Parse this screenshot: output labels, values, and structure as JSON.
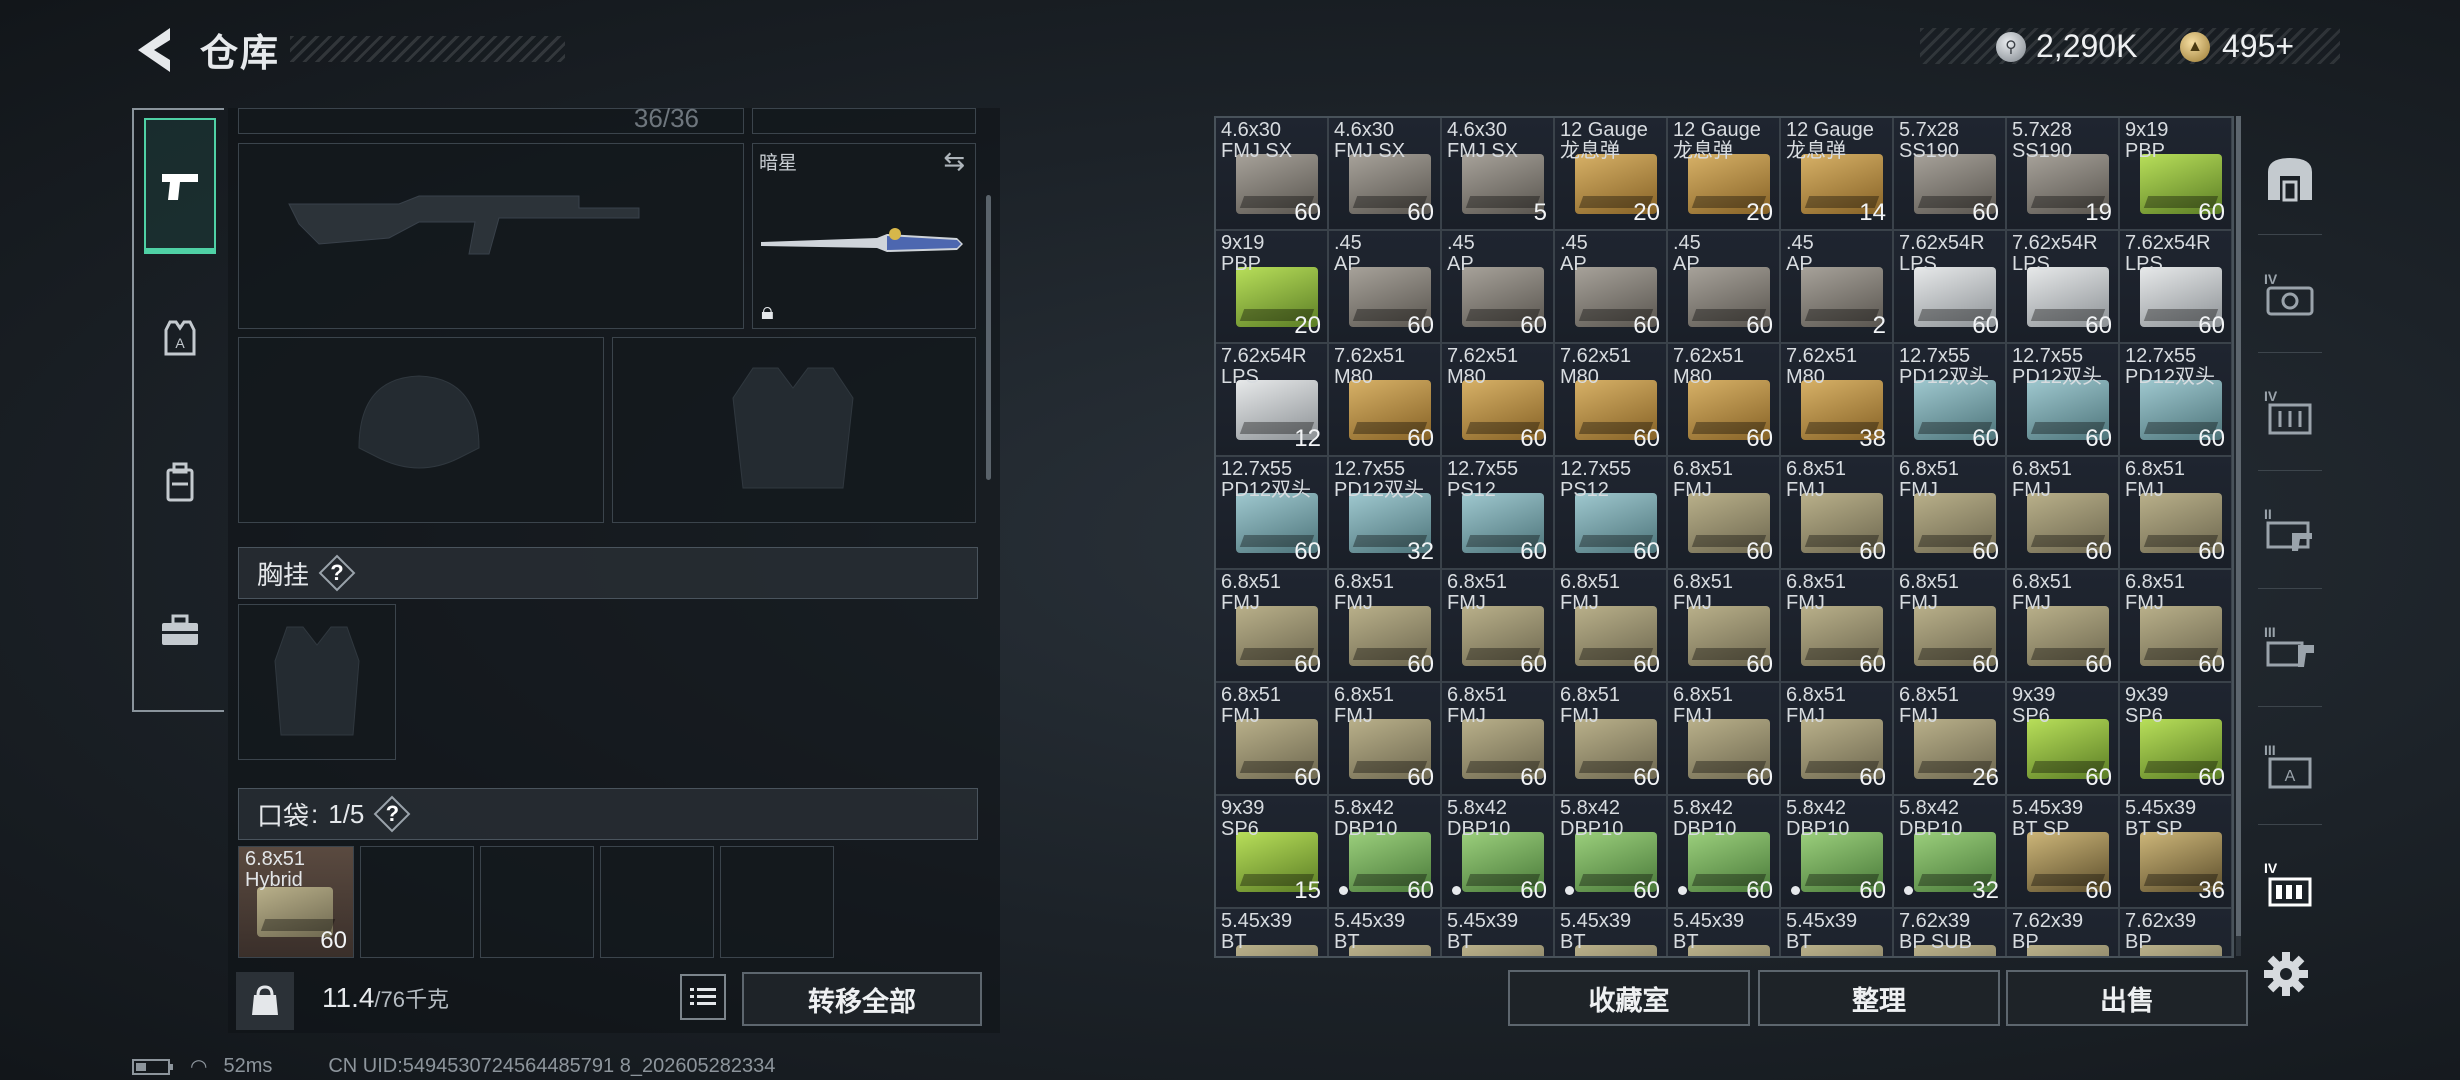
{
  "header": {
    "title": "仓库"
  },
  "currency": {
    "silver": "2,290K",
    "gold": "495+"
  },
  "left_nav": {
    "items": [
      "weapons",
      "armor",
      "backpack",
      "tools"
    ]
  },
  "equipment": {
    "top_partial_text": "36/36",
    "melee_name": "暗星",
    "chest_rig_label": "胸挂",
    "pocket_label": "口袋",
    "pocket_count": "1/5",
    "pocket_item": {
      "name": "6.8x51\nHybrid",
      "qty": "60"
    }
  },
  "bottom_left": {
    "weight": "11.4",
    "weight_max": "/76千克",
    "transfer_all": "转移全部"
  },
  "inventory_items": [
    {
      "name": "4.6x30\nFMJ SX",
      "qty": "60",
      "box": "gray"
    },
    {
      "name": "4.6x30\nFMJ SX",
      "qty": "60",
      "box": "gray"
    },
    {
      "name": "4.6x30\nFMJ SX",
      "qty": "5",
      "box": "gray"
    },
    {
      "name": "12 Gauge\n龙息弹",
      "qty": "20",
      "box": "gold"
    },
    {
      "name": "12 Gauge\n龙息弹",
      "qty": "20",
      "box": "gold"
    },
    {
      "name": "12 Gauge\n龙息弹",
      "qty": "14",
      "box": "gold"
    },
    {
      "name": "5.7x28\nSS190",
      "qty": "60",
      "box": "gray"
    },
    {
      "name": "5.7x28\nSS190",
      "qty": "19",
      "box": "gray"
    },
    {
      "name": "9x19\nPBP",
      "qty": "60",
      "box": "green"
    },
    {
      "name": "9x19\nPBP",
      "qty": "20",
      "box": "green"
    },
    {
      "name": ".45\nAP",
      "qty": "60",
      "box": "gray"
    },
    {
      "name": ".45\nAP",
      "qty": "60",
      "box": "gray"
    },
    {
      "name": ".45\nAP",
      "qty": "60",
      "box": "gray"
    },
    {
      "name": ".45\nAP",
      "qty": "60",
      "box": "gray"
    },
    {
      "name": ".45\nAP",
      "qty": "2",
      "box": "gray"
    },
    {
      "name": "7.62x54R\nLPS",
      "qty": "60",
      "box": "white"
    },
    {
      "name": "7.62x54R\nLPS",
      "qty": "60",
      "box": "white"
    },
    {
      "name": "7.62x54R\nLPS",
      "qty": "60",
      "box": "white"
    },
    {
      "name": "7.62x54R\nLPS",
      "qty": "12",
      "box": "white"
    },
    {
      "name": "7.62x51\nM80",
      "qty": "60",
      "box": "gold"
    },
    {
      "name": "7.62x51\nM80",
      "qty": "60",
      "box": "gold"
    },
    {
      "name": "7.62x51\nM80",
      "qty": "60",
      "box": "gold"
    },
    {
      "name": "7.62x51\nM80",
      "qty": "60",
      "box": "gold"
    },
    {
      "name": "7.62x51\nM80",
      "qty": "38",
      "box": "gold"
    },
    {
      "name": "12.7x55\nPD12双头",
      "qty": "60",
      "box": "teal"
    },
    {
      "name": "12.7x55\nPD12双头",
      "qty": "60",
      "box": "teal"
    },
    {
      "name": "12.7x55\nPD12双头",
      "qty": "60",
      "box": "teal"
    },
    {
      "name": "12.7x55\nPD12双头",
      "qty": "60",
      "box": "teal"
    },
    {
      "name": "12.7x55\nPD12双头",
      "qty": "32",
      "box": "teal"
    },
    {
      "name": "12.7x55\nPS12",
      "qty": "60",
      "box": "teal"
    },
    {
      "name": "12.7x55\nPS12",
      "qty": "60",
      "box": "teal"
    },
    {
      "name": "6.8x51\nFMJ",
      "qty": "60",
      "box": "fmj"
    },
    {
      "name": "6.8x51\nFMJ",
      "qty": "60",
      "box": "fmj"
    },
    {
      "name": "6.8x51\nFMJ",
      "qty": "60",
      "box": "fmj"
    },
    {
      "name": "6.8x51\nFMJ",
      "qty": "60",
      "box": "fmj"
    },
    {
      "name": "6.8x51\nFMJ",
      "qty": "60",
      "box": "fmj"
    },
    {
      "name": "6.8x51\nFMJ",
      "qty": "60",
      "box": "fmj"
    },
    {
      "name": "6.8x51\nFMJ",
      "qty": "60",
      "box": "fmj"
    },
    {
      "name": "6.8x51\nFMJ",
      "qty": "60",
      "box": "fmj"
    },
    {
      "name": "6.8x51\nFMJ",
      "qty": "60",
      "box": "fmj"
    },
    {
      "name": "6.8x51\nFMJ",
      "qty": "60",
      "box": "fmj"
    },
    {
      "name": "6.8x51\nFMJ",
      "qty": "60",
      "box": "fmj"
    },
    {
      "name": "6.8x51\nFMJ",
      "qty": "60",
      "box": "fmj"
    },
    {
      "name": "6.8x51\nFMJ",
      "qty": "60",
      "box": "fmj"
    },
    {
      "name": "6.8x51\nFMJ",
      "qty": "60",
      "box": "fmj"
    },
    {
      "name": "6.8x51\nFMJ",
      "qty": "60",
      "box": "fmj"
    },
    {
      "name": "6.8x51\nFMJ",
      "qty": "60",
      "box": "fmj"
    },
    {
      "name": "6.8x51\nFMJ",
      "qty": "60",
      "box": "fmj"
    },
    {
      "name": "6.8x51\nFMJ",
      "qty": "60",
      "box": "fmj"
    },
    {
      "name": "6.8x51\nFMJ",
      "qty": "60",
      "box": "fmj"
    },
    {
      "name": "6.8x51\nFMJ",
      "qty": "60",
      "box": "fmj"
    },
    {
      "name": "6.8x51\nFMJ",
      "qty": "26",
      "box": "fmj"
    },
    {
      "name": "9x39\nSP6",
      "qty": "60",
      "box": "green"
    },
    {
      "name": "9x39\nSP6",
      "qty": "60",
      "box": "green"
    },
    {
      "name": "9x39\nSP6",
      "qty": "15",
      "box": "green"
    },
    {
      "name": "5.8x42\nDBP10",
      "qty": "60",
      "box": "grn2",
      "dot": true
    },
    {
      "name": "5.8x42\nDBP10",
      "qty": "60",
      "box": "grn2",
      "dot": true
    },
    {
      "name": "5.8x42\nDBP10",
      "qty": "60",
      "box": "grn2",
      "dot": true
    },
    {
      "name": "5.8x42\nDBP10",
      "qty": "60",
      "box": "grn2",
      "dot": true
    },
    {
      "name": "5.8x42\nDBP10",
      "qty": "60",
      "box": "grn2",
      "dot": true
    },
    {
      "name": "5.8x42\nDBP10",
      "qty": "32",
      "box": "grn2",
      "dot": true
    },
    {
      "name": "5.45x39\nBT SP",
      "qty": "60",
      "box": "brass"
    },
    {
      "name": "5.45x39\nBT SP",
      "qty": "36",
      "box": "brass"
    },
    {
      "name": "5.45x39\nBT",
      "qty": "",
      "box": "fmj"
    },
    {
      "name": "5.45x39\nBT",
      "qty": "",
      "box": "fmj"
    },
    {
      "name": "5.45x39\nBT",
      "qty": "",
      "box": "fmj"
    },
    {
      "name": "5.45x39\nBT",
      "qty": "",
      "box": "fmj"
    },
    {
      "name": "5.45x39\nBT",
      "qty": "",
      "box": "fmj"
    },
    {
      "name": "5.45x39\nBT",
      "qty": "",
      "box": "fmj"
    },
    {
      "name": "7.62x39\nBP SUB",
      "qty": "",
      "box": "fmj"
    },
    {
      "name": "7.62x39\nBP",
      "qty": "",
      "box": "fmj"
    },
    {
      "name": "7.62x39\nBP",
      "qty": "",
      "box": "fmj"
    }
  ],
  "bottom_right": {
    "stash": "收藏室",
    "sort": "整理",
    "sell": "出售"
  },
  "status_bar": {
    "ping": "52ms",
    "uid": "CN UID:5494530724564485791 8_202605282334"
  },
  "colors": {
    "accent": "#4fd1a5",
    "panel": "#1a1f28"
  }
}
